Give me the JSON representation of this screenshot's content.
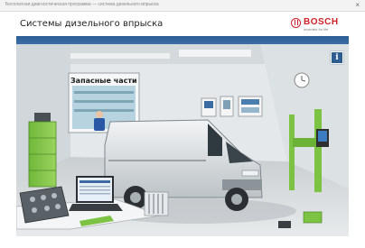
{
  "window": {
    "title": "Бесплатная диагностическая программа — система дизельного впрыска",
    "close_glyph": "×"
  },
  "app": {
    "title": "Системы дизельного впрыска",
    "brand": "BOSCH",
    "brand_tagline": "Invented for life",
    "accent_blue": "#2e5d92",
    "brand_red": "#d0202a"
  },
  "scene": {
    "parts_label": "Запасные части",
    "info_glyph": "i",
    "equipment_green": "#7cc243"
  }
}
